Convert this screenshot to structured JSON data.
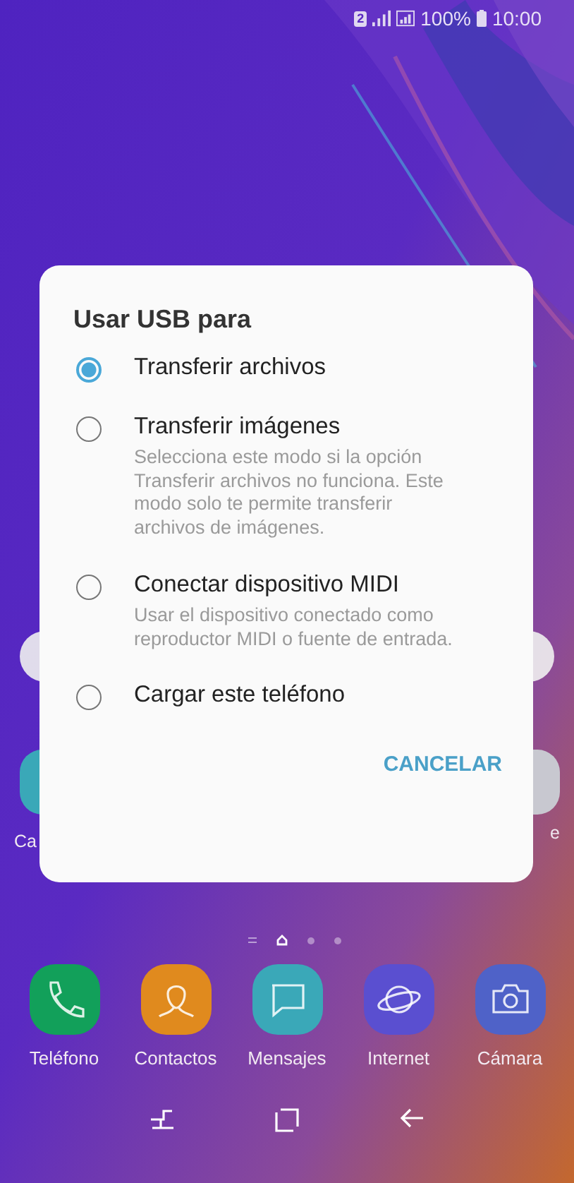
{
  "status_bar": {
    "sim": "2",
    "battery": "100%",
    "time": "10:00"
  },
  "home_partial": {
    "left_label": "Ca",
    "right_label_lines": [
      "e"
    ]
  },
  "dialog": {
    "title": "Usar USB para",
    "options": [
      {
        "label": "Transferir archivos",
        "selected": true
      },
      {
        "label": "Transferir imágenes",
        "description": "Selecciona este modo si la opción Transferir archivos no funciona. Este modo solo te permite transferir archivos de imágenes.",
        "selected": false
      },
      {
        "label": "Conectar dispositivo MIDI",
        "description": "Usar el dispositivo conectado como reproductor MIDI o fuente de entrada.",
        "selected": false
      },
      {
        "label": "Cargar este teléfono",
        "selected": false
      }
    ],
    "cancel_button": "CANCELAR"
  },
  "dock": [
    {
      "label": "Teléfono",
      "kind": "phone",
      "color": "#12a05a"
    },
    {
      "label": "Contactos",
      "kind": "contacts",
      "color": "#e08a1e"
    },
    {
      "label": "Mensajes",
      "kind": "messages",
      "color": "#3aa8b8"
    },
    {
      "label": "Internet",
      "kind": "internet",
      "color": "#5a4fd0"
    },
    {
      "label": "Cámara",
      "kind": "camera",
      "color": "#4f62c8"
    }
  ]
}
